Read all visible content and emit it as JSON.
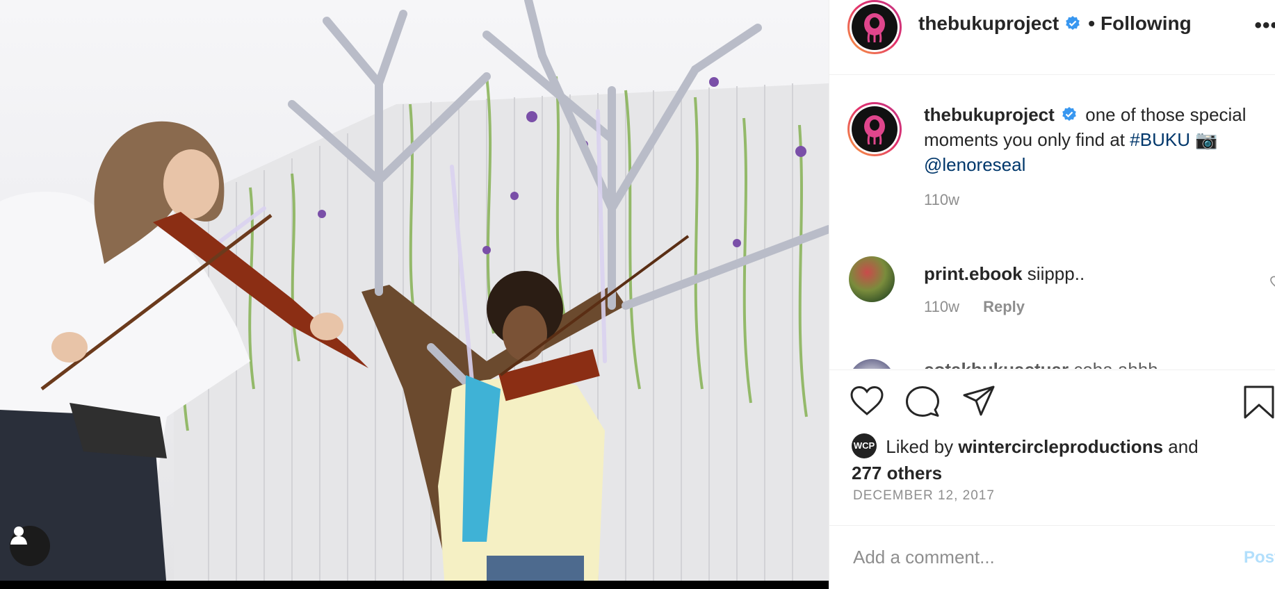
{
  "post": {
    "username": "thebukuproject",
    "follow_status": "Following",
    "separator": "•",
    "more_label": "•••"
  },
  "caption": {
    "username": "thebukuproject",
    "text_before": "one of those special moments you only find at",
    "hashtag": "#BUKU",
    "camera_emoji": "📷",
    "mention": "@lenoreseal",
    "time": "110w"
  },
  "comments": [
    {
      "username": "print.ebook",
      "text": "siippp..",
      "time": "110w",
      "reply_label": "Reply"
    },
    {
      "username": "cotakbukuactuar",
      "text": "coba ahhh"
    }
  ],
  "likes": {
    "prefix": "Liked by",
    "user": "wintercircleproductions",
    "conjunction": "and",
    "others": "277 others",
    "avatar_text": "WCP"
  },
  "date": "DECEMBER 12, 2017",
  "comment_box": {
    "placeholder": "Add a comment...",
    "post_label": "Post"
  },
  "icons": {
    "verified": "verified-badge-icon",
    "like": "heart-icon",
    "comment": "speech-bubble-icon",
    "share": "paper-plane-icon",
    "save": "bookmark-icon",
    "tag": "user-tag-icon"
  },
  "colors": {
    "verified_blue": "#3897f0",
    "link_blue": "#00376b",
    "post_disabled": "#b2dffc",
    "muted": "#8e8e8e"
  }
}
